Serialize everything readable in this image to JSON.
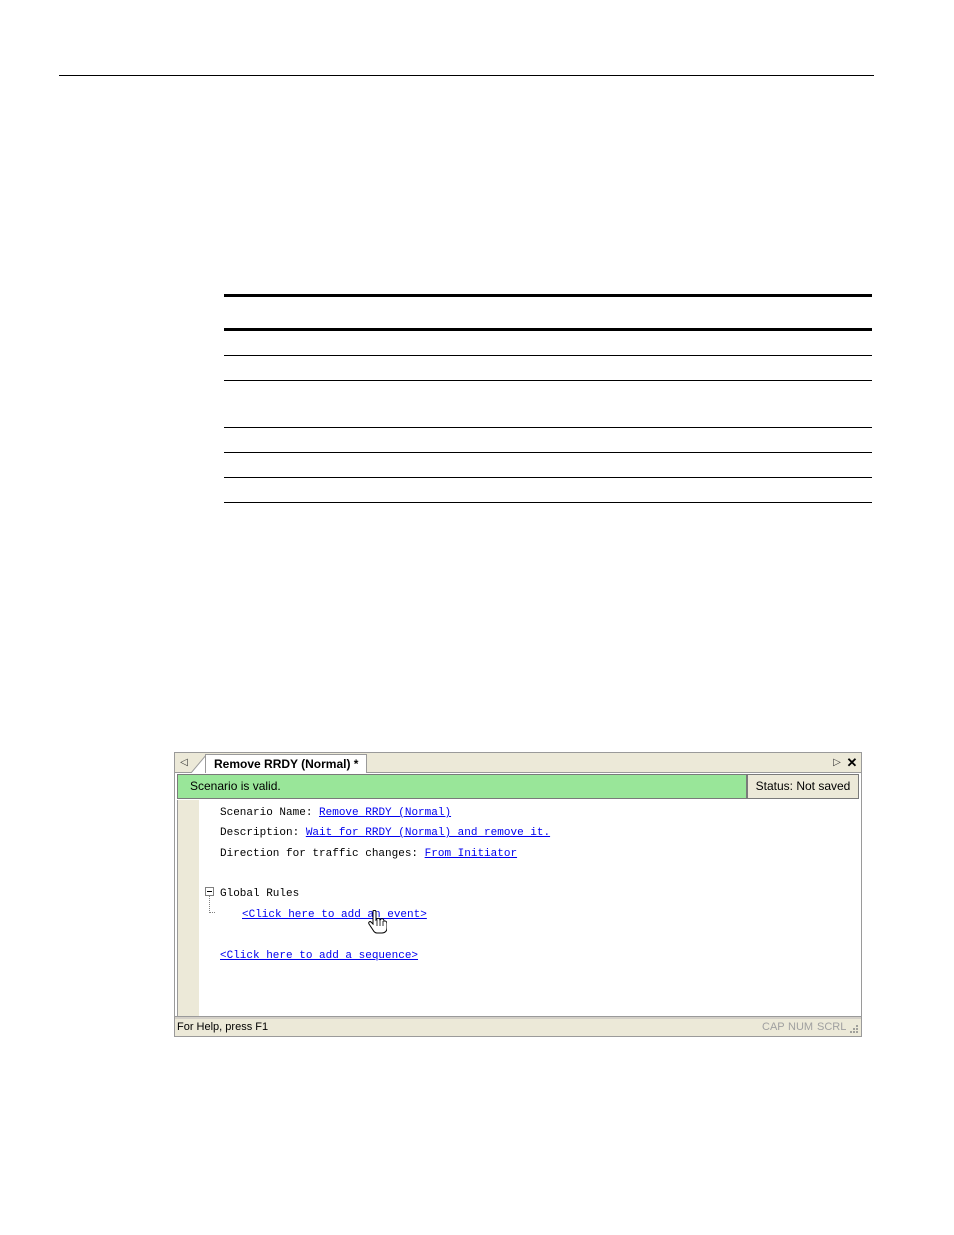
{
  "window": {
    "tab": {
      "scroll_left_icon": "◁",
      "title": "Remove RRDY (Normal) *",
      "scroll_right_icon": "▷",
      "close_icon": "✕"
    },
    "validation": {
      "message": "Scenario is valid.",
      "status": "Status: Not saved",
      "colors": {
        "valid_bg": "#99e699"
      }
    },
    "editor": {
      "scenario_name_label": "Scenario Name: ",
      "scenario_name_value": "Remove RRDY (Normal)",
      "description_label": "Description: ",
      "description_value": "Wait for RRDY (Normal) and remove it.",
      "direction_label": "Direction for traffic changes: ",
      "direction_value": "From Initiator",
      "global_rules_label": "Global Rules",
      "add_event_link": "<Click here to add an event>",
      "add_sequence_link": "<Click here to add a sequence>",
      "link_color": "#0000ee"
    },
    "statusbar": {
      "help": "For Help, press F1",
      "indicators": [
        "CAP",
        "NUM",
        "SCRL"
      ]
    }
  }
}
